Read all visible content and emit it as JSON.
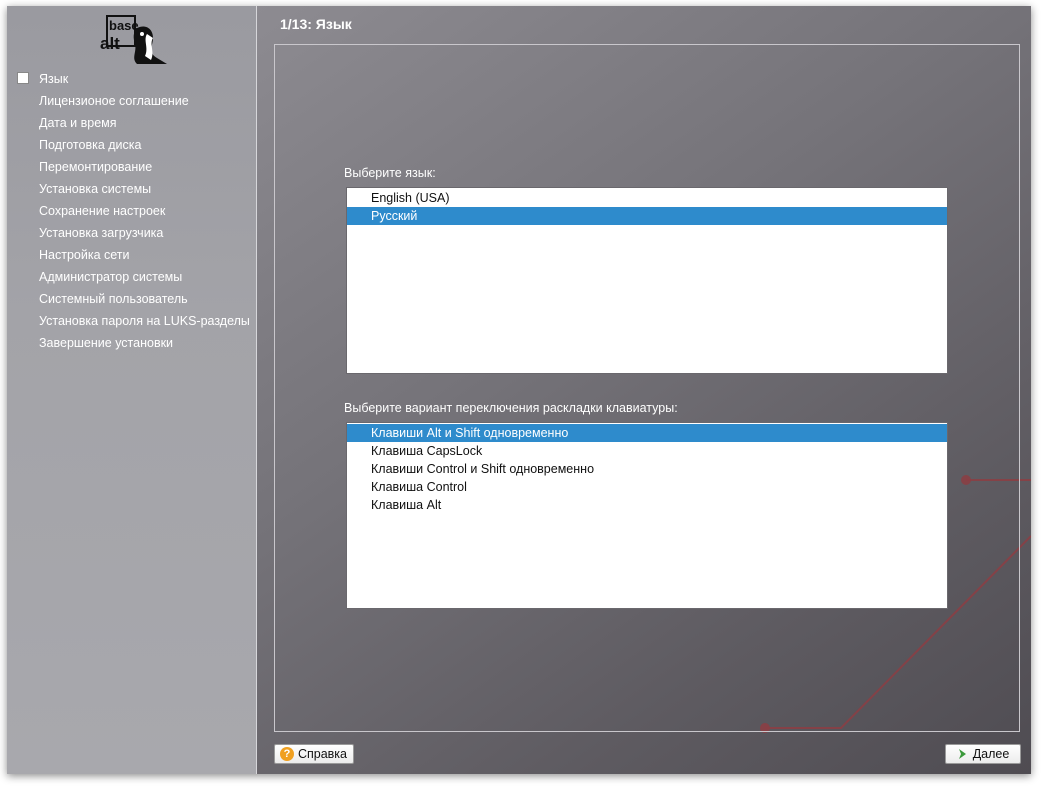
{
  "logo": {
    "line1": "base",
    "line2": "alt"
  },
  "header": {
    "title": "1/13: Язык"
  },
  "sidebar": {
    "steps": [
      {
        "label": "Язык",
        "current": true
      },
      {
        "label": "Лицензионое соглашение"
      },
      {
        "label": "Дата и время"
      },
      {
        "label": "Подготовка диска"
      },
      {
        "label": "Перемонтирование"
      },
      {
        "label": "Установка системы"
      },
      {
        "label": "Сохранение настроек"
      },
      {
        "label": "Установка загрузчика"
      },
      {
        "label": "Настройка сети"
      },
      {
        "label": "Администратор системы"
      },
      {
        "label": "Системный пользователь"
      },
      {
        "label": "Установка пароля на LUKS-разделы"
      },
      {
        "label": "Завершение установки"
      }
    ]
  },
  "language": {
    "label": "Выберите язык:",
    "options": [
      "English (USA)",
      "Русский"
    ],
    "selected_index": 1
  },
  "keyboard": {
    "label": "Выберите вариант переключения раскладки клавиатуры:",
    "options": [
      "Клавиши Alt и Shift одновременно",
      "Клавиша CapsLock",
      "Клавиши Control и Shift одновременно",
      "Клавиша Control",
      "Клавиша Alt"
    ],
    "selected_index": 0
  },
  "footer": {
    "help_label": "Справка",
    "next_label": "Далее"
  },
  "colors": {
    "selection": "#2e8bcc",
    "decor_line": "#8a3f45",
    "help_icon": "#f0a020",
    "next_icon": "#3c9a3c"
  }
}
